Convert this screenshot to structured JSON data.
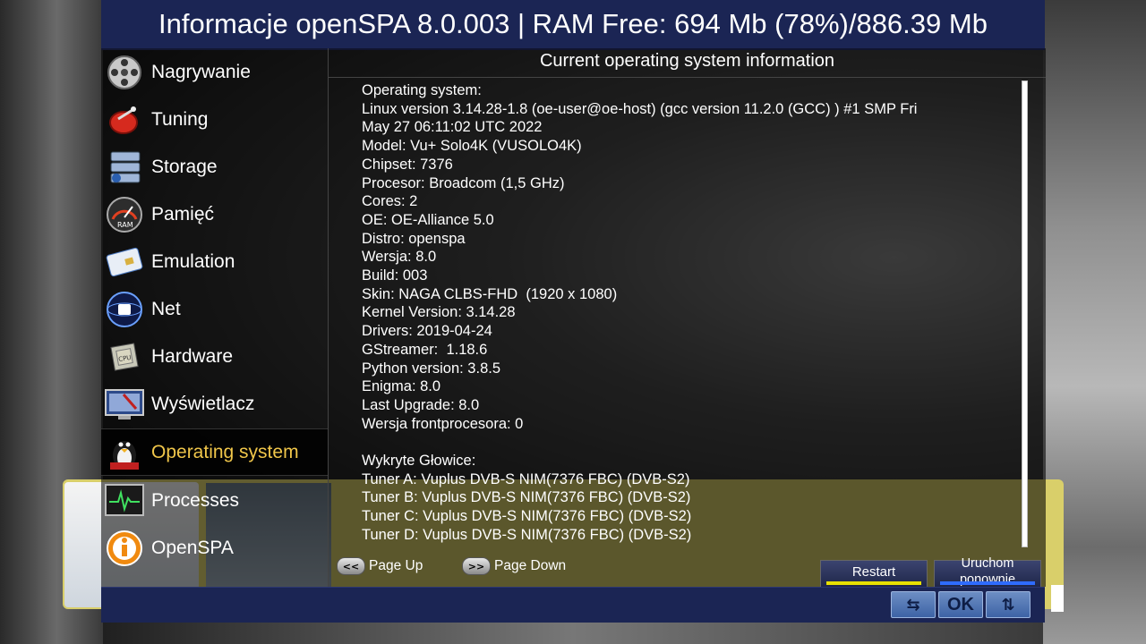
{
  "window": {
    "title": "Informacje openSPA 8.0.003 | RAM Free: 694 Mb (78%)/886.39 Mb"
  },
  "sidebar": {
    "items": [
      {
        "label": "Nagrywanie",
        "icon": "film-reel-icon",
        "selected": false
      },
      {
        "label": "Tuning",
        "icon": "satellite-dish-icon",
        "selected": false
      },
      {
        "label": "Storage",
        "icon": "hard-drive-icon",
        "selected": false
      },
      {
        "label": "Pamięć",
        "icon": "ram-gauge-icon",
        "selected": false
      },
      {
        "label": "Emulation",
        "icon": "smart-card-icon",
        "selected": false
      },
      {
        "label": "Net",
        "icon": "network-icon",
        "selected": false
      },
      {
        "label": "Hardware",
        "icon": "cpu-icon",
        "selected": false
      },
      {
        "label": "Wyświetlacz",
        "icon": "monitor-icon",
        "selected": false
      },
      {
        "label": "Operating system",
        "icon": "linux-penguin-icon",
        "selected": true
      },
      {
        "label": "Processes",
        "icon": "activity-monitor-icon",
        "selected": false
      },
      {
        "label": "OpenSPA",
        "icon": "info-icon",
        "selected": false
      }
    ]
  },
  "content": {
    "header": "Current operating system information",
    "info_lines": [
      "Operating system:",
      "Linux version 3.14.28-1.8 (oe-user@oe-host) (gcc version 11.2.0 (GCC) ) #1 SMP Fri",
      "May 27 06:11:02 UTC 2022",
      "Model: Vu+ Solo4K (VUSOLO4K)",
      "Chipset: 7376",
      "Procesor: Broadcom (1,5 GHz)",
      "Cores: 2",
      "OE: OE-Alliance 5.0",
      "Distro: openspa",
      "Wersja: 8.0",
      "Build: 003",
      "Skin: NAGA CLBS-FHD  (1920 x 1080)",
      "Kernel Version: 3.14.28",
      "Drivers: 2019-04-24",
      "GStreamer:  1.18.6",
      "Python version: 3.8.5",
      "Enigma: 8.0",
      "Last Upgrade: 8.0",
      "Wersja frontprocesora: 0",
      "",
      "Wykryte Głowice:",
      "Tuner A: Vuplus DVB-S NIM(7376 FBC) (DVB-S2)",
      "Tuner B: Vuplus DVB-S NIM(7376 FBC) (DVB-S2)",
      "Tuner C: Vuplus DVB-S NIM(7376 FBC) (DVB-S2)",
      "Tuner D: Vuplus DVB-S NIM(7376 FBC) (DVB-S2)"
    ]
  },
  "nav": {
    "page_up_key": "<<",
    "page_up": "Page Up",
    "page_down_key": ">>",
    "page_down": "Page Down"
  },
  "buttons": {
    "yellow": {
      "label": "Restart",
      "color": "#e8e000"
    },
    "blue": {
      "label": "Uruchom\nponownie",
      "color": "#2f6cff"
    }
  },
  "footer": {
    "keys": [
      {
        "label": "⇆",
        "icon": "swap-arrows-icon"
      },
      {
        "label": "OK",
        "icon": "ok-key-icon"
      },
      {
        "label": "⇅",
        "icon": "updown-arrows-icon"
      }
    ]
  }
}
